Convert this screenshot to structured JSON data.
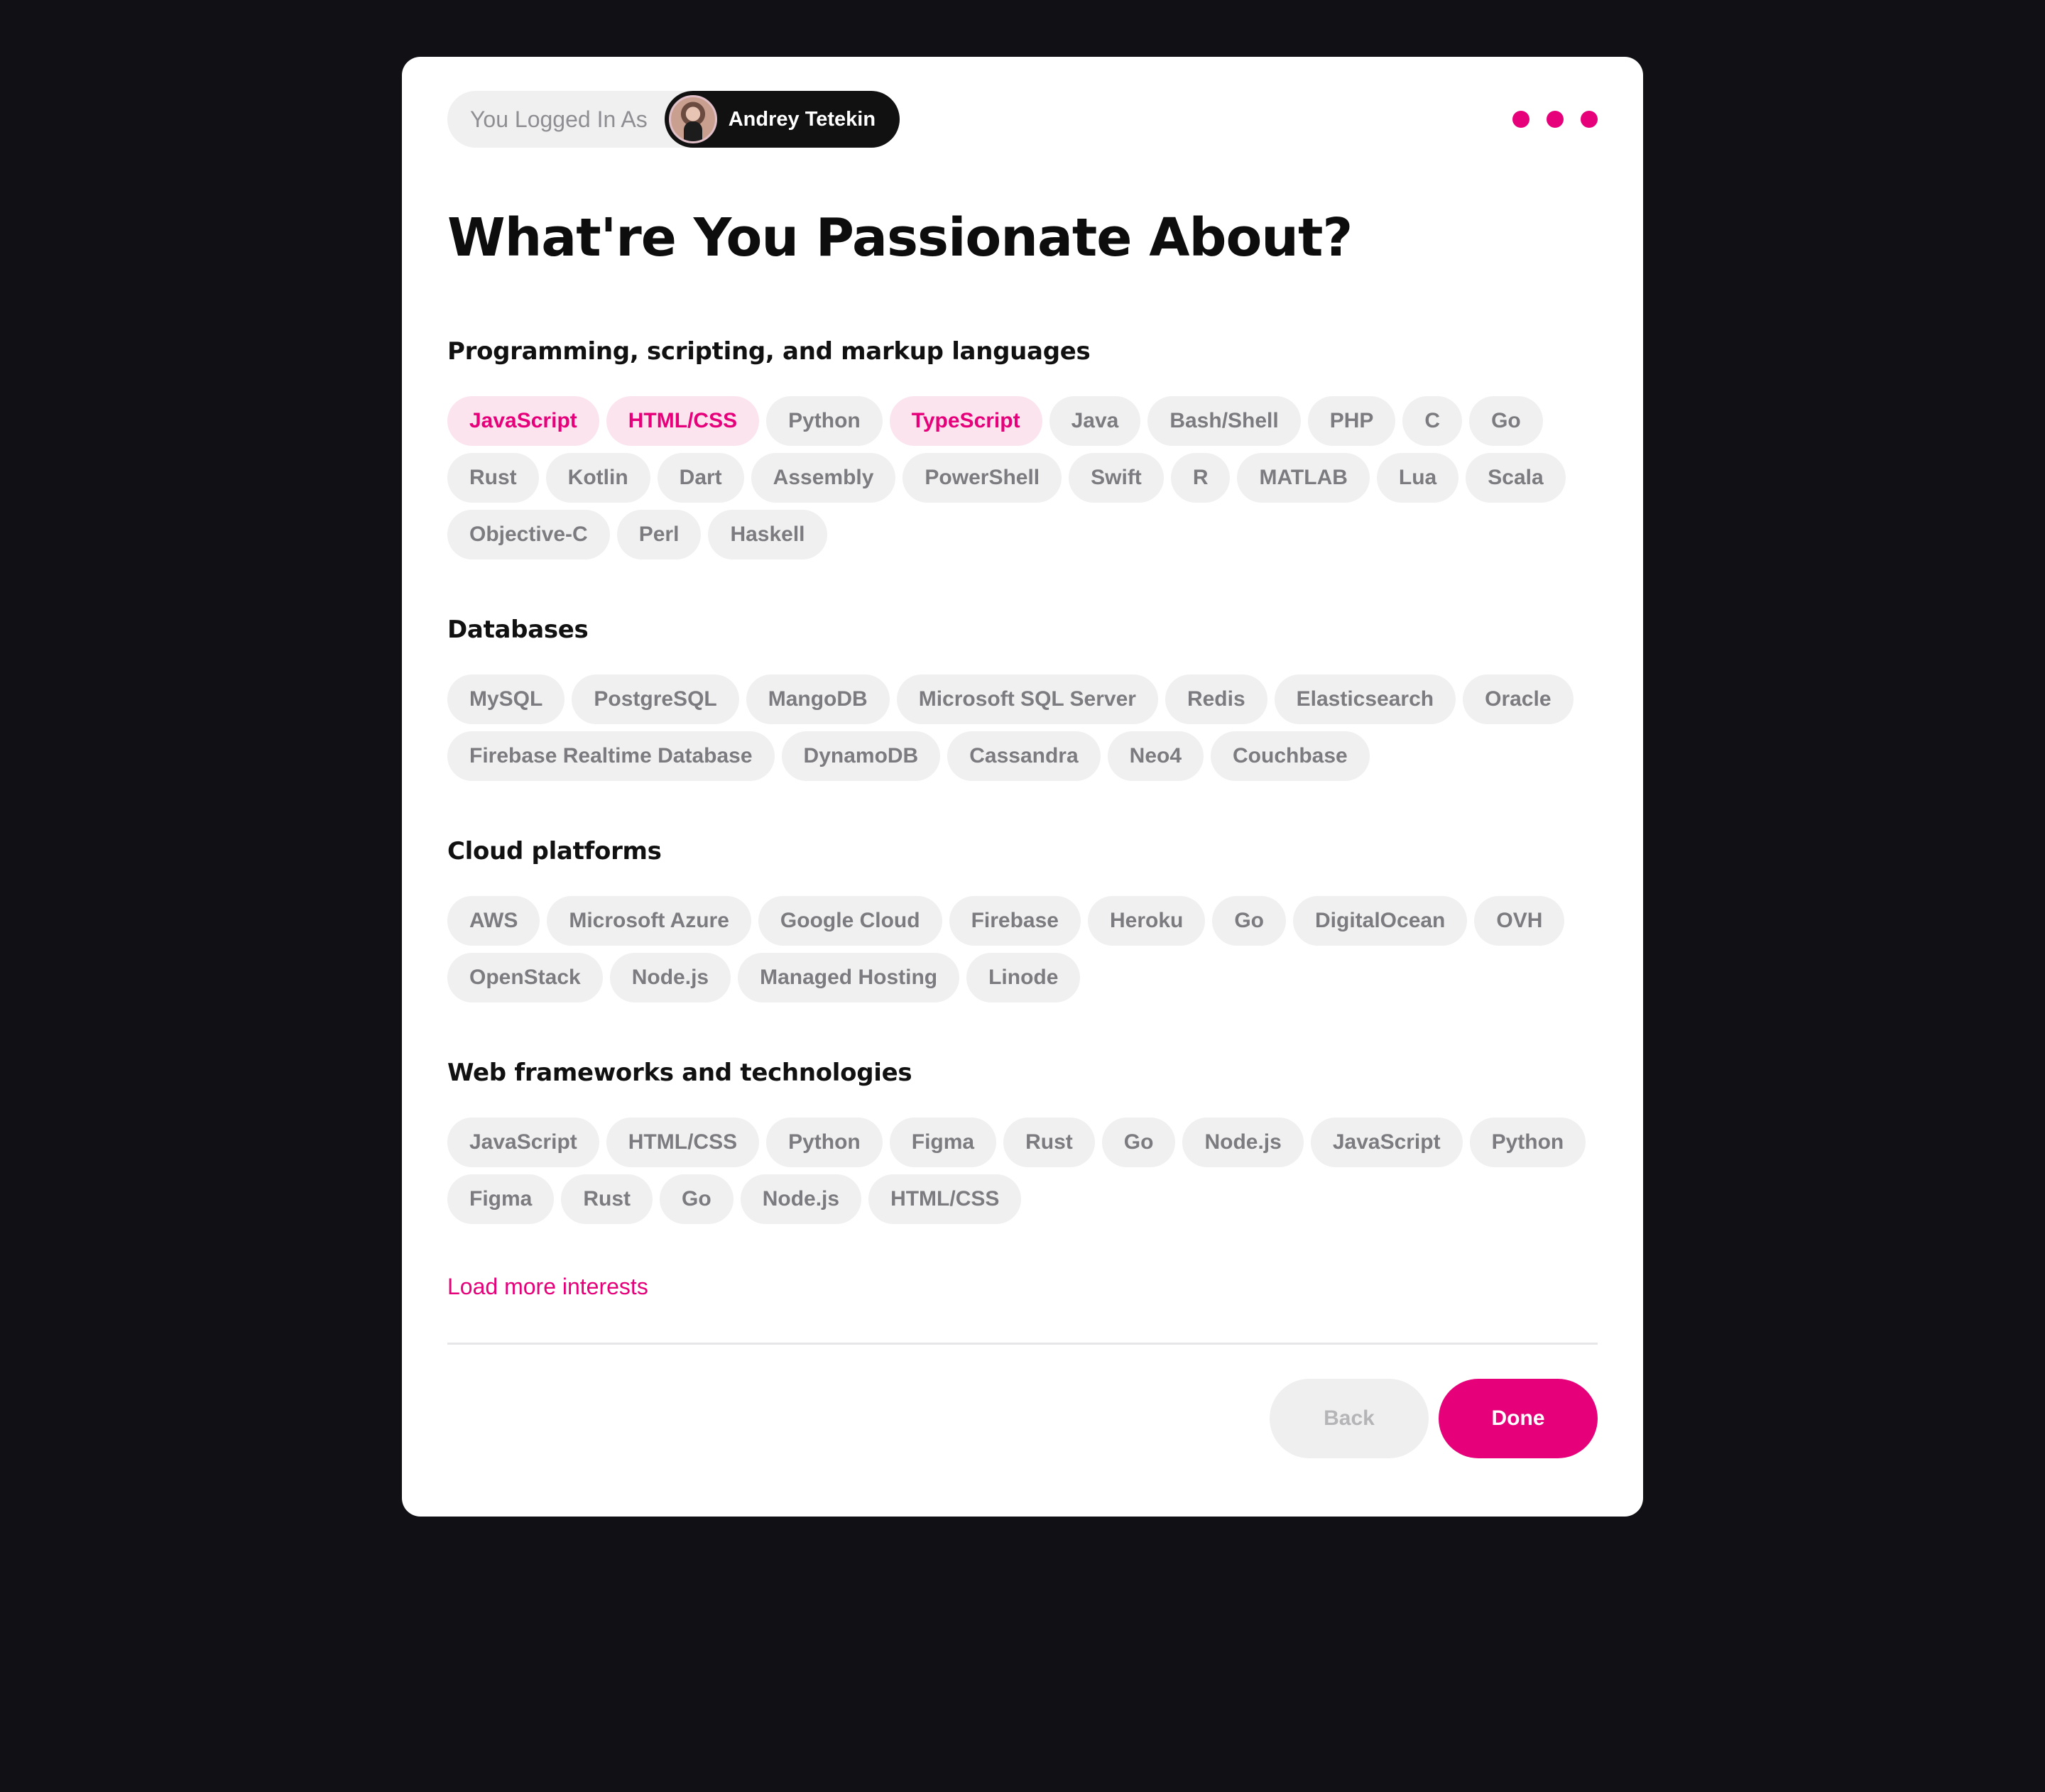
{
  "header": {
    "login_label": "You Logged In As",
    "user_name": "Andrey Tetekin"
  },
  "title": "What're You Passionate About?",
  "sections": [
    {
      "title": "Programming, scripting, and markup languages",
      "tags": [
        {
          "label": "JavaScript",
          "selected": true
        },
        {
          "label": "HTML/CSS",
          "selected": true
        },
        {
          "label": "Python",
          "selected": false
        },
        {
          "label": "TypeScript",
          "selected": true
        },
        {
          "label": "Java",
          "selected": false
        },
        {
          "label": "Bash/Shell",
          "selected": false
        },
        {
          "label": "PHP",
          "selected": false
        },
        {
          "label": "C",
          "selected": false
        },
        {
          "label": "Go",
          "selected": false
        },
        {
          "label": "Rust",
          "selected": false
        },
        {
          "label": "Kotlin",
          "selected": false
        },
        {
          "label": "Dart",
          "selected": false
        },
        {
          "label": "Assembly",
          "selected": false
        },
        {
          "label": "PowerShell",
          "selected": false
        },
        {
          "label": "Swift",
          "selected": false
        },
        {
          "label": "R",
          "selected": false
        },
        {
          "label": "MATLAB",
          "selected": false
        },
        {
          "label": "Lua",
          "selected": false
        },
        {
          "label": "Scala",
          "selected": false
        },
        {
          "label": "Objective-C",
          "selected": false
        },
        {
          "label": "Perl",
          "selected": false
        },
        {
          "label": "Haskell",
          "selected": false
        }
      ]
    },
    {
      "title": "Databases",
      "tags": [
        {
          "label": "MySQL",
          "selected": false
        },
        {
          "label": "PostgreSQL",
          "selected": false
        },
        {
          "label": "MangoDB",
          "selected": false
        },
        {
          "label": "Microsoft SQL Server",
          "selected": false
        },
        {
          "label": "Redis",
          "selected": false
        },
        {
          "label": "Elasticsearch",
          "selected": false
        },
        {
          "label": "Oracle",
          "selected": false
        },
        {
          "label": "Firebase Realtime Database",
          "selected": false
        },
        {
          "label": "DynamoDB",
          "selected": false
        },
        {
          "label": "Cassandra",
          "selected": false
        },
        {
          "label": "Neo4",
          "selected": false
        },
        {
          "label": "Couchbase",
          "selected": false
        }
      ]
    },
    {
      "title": "Cloud platforms",
      "tags": [
        {
          "label": "AWS",
          "selected": false
        },
        {
          "label": "Microsoft Azure",
          "selected": false
        },
        {
          "label": "Google Cloud",
          "selected": false
        },
        {
          "label": "Firebase",
          "selected": false
        },
        {
          "label": "Heroku",
          "selected": false
        },
        {
          "label": "Go",
          "selected": false
        },
        {
          "label": "DigitalOcean",
          "selected": false
        },
        {
          "label": "OVH",
          "selected": false
        },
        {
          "label": "OpenStack",
          "selected": false
        },
        {
          "label": "Node.js",
          "selected": false
        },
        {
          "label": "Managed Hosting",
          "selected": false
        },
        {
          "label": "Linode",
          "selected": false
        }
      ]
    },
    {
      "title": "Web frameworks and technologies",
      "tags": [
        {
          "label": "JavaScript",
          "selected": false
        },
        {
          "label": "HTML/CSS",
          "selected": false
        },
        {
          "label": "Python",
          "selected": false
        },
        {
          "label": "Figma",
          "selected": false
        },
        {
          "label": "Rust",
          "selected": false
        },
        {
          "label": "Go",
          "selected": false
        },
        {
          "label": "Node.js",
          "selected": false
        },
        {
          "label": "JavaScript",
          "selected": false
        },
        {
          "label": "Python",
          "selected": false
        },
        {
          "label": "Figma",
          "selected": false
        },
        {
          "label": "Rust",
          "selected": false
        },
        {
          "label": "Go",
          "selected": false
        },
        {
          "label": "Node.js",
          "selected": false
        },
        {
          "label": "HTML/CSS",
          "selected": false
        }
      ]
    }
  ],
  "load_more": "Load more interests",
  "footer": {
    "back_label": "Back",
    "done_label": "Done"
  },
  "colors": {
    "accent": "#e6007a",
    "selected_bg": "#fce4ef",
    "tag_bg": "#f0f0f0",
    "tag_text": "#7c7c80",
    "background": "#111015"
  }
}
